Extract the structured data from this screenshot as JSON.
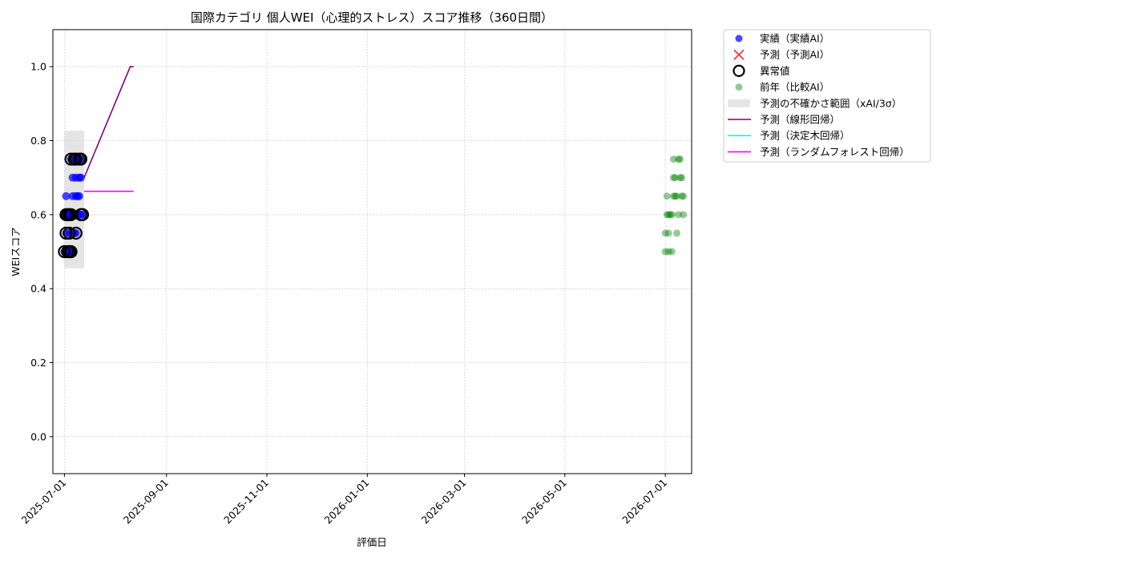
{
  "chart_data": {
    "type": "scatter",
    "title": "国際カテゴリ 個人WEI（心理的ストレス）スコア推移（360日間）",
    "xlabel": "評価日",
    "ylabel": "WEIスコア",
    "xlim": [
      "2025-06-24",
      "2026-07-17"
    ],
    "ylim": [
      -0.1,
      1.1
    ],
    "yticks": [
      0.0,
      0.2,
      0.4,
      0.6,
      0.8,
      1.0
    ],
    "ytick_labels": [
      "0.0",
      "0.2",
      "0.4",
      "0.6",
      "0.8",
      "1.0"
    ],
    "xticks": [
      "2025-07-01",
      "2025-09-01",
      "2025-11-01",
      "2026-01-01",
      "2026-03-01",
      "2026-05-01",
      "2026-07-01"
    ],
    "grid": true,
    "legend_position": "outside upper-right",
    "series": [
      {
        "name": "実績（実績AI）",
        "kind": "scatter",
        "color": "#0000ff",
        "points": [
          [
            "2025-07-01",
            0.5
          ],
          [
            "2025-07-02",
            0.55
          ],
          [
            "2025-07-02",
            0.6
          ],
          [
            "2025-07-02",
            0.65
          ],
          [
            "2025-07-03",
            0.5
          ],
          [
            "2025-07-03",
            0.6
          ],
          [
            "2025-07-04",
            0.55
          ],
          [
            "2025-07-04",
            0.5
          ],
          [
            "2025-07-04",
            0.6
          ],
          [
            "2025-07-05",
            0.75
          ],
          [
            "2025-07-05",
            0.6
          ],
          [
            "2025-07-05",
            0.5
          ],
          [
            "2025-07-06",
            0.7
          ],
          [
            "2025-07-06",
            0.65
          ],
          [
            "2025-07-07",
            0.6
          ],
          [
            "2025-07-07",
            0.75
          ],
          [
            "2025-07-07",
            0.55
          ],
          [
            "2025-07-08",
            0.75
          ],
          [
            "2025-07-08",
            0.7
          ],
          [
            "2025-07-08",
            0.65
          ],
          [
            "2025-07-08",
            0.55
          ],
          [
            "2025-07-09",
            0.75
          ],
          [
            "2025-07-09",
            0.65
          ],
          [
            "2025-07-09",
            0.6
          ],
          [
            "2025-07-10",
            0.75
          ],
          [
            "2025-07-10",
            0.7
          ],
          [
            "2025-07-10",
            0.65
          ],
          [
            "2025-07-11",
            0.75
          ],
          [
            "2025-07-11",
            0.7
          ],
          [
            "2025-07-11",
            0.6
          ],
          [
            "2025-07-12",
            0.6
          ]
        ]
      },
      {
        "name": "予測（予測AI）",
        "kind": "marker-x",
        "color": "#ff0000",
        "points": []
      },
      {
        "name": "異常値",
        "kind": "ring",
        "color": "#000000",
        "points": [
          [
            "2025-07-01",
            0.5
          ],
          [
            "2025-07-02",
            0.55
          ],
          [
            "2025-07-02",
            0.6
          ],
          [
            "2025-07-03",
            0.5
          ],
          [
            "2025-07-03",
            0.6
          ],
          [
            "2025-07-04",
            0.55
          ],
          [
            "2025-07-04",
            0.5
          ],
          [
            "2025-07-04",
            0.6
          ],
          [
            "2025-07-05",
            0.75
          ],
          [
            "2025-07-05",
            0.6
          ],
          [
            "2025-07-05",
            0.5
          ],
          [
            "2025-07-07",
            0.75
          ],
          [
            "2025-07-08",
            0.75
          ],
          [
            "2025-07-08",
            0.55
          ],
          [
            "2025-07-10",
            0.75
          ],
          [
            "2025-07-11",
            0.75
          ],
          [
            "2025-07-11",
            0.6
          ],
          [
            "2025-07-12",
            0.6
          ]
        ]
      },
      {
        "name": "前年（比較AI）",
        "kind": "scatter",
        "color": "#008000",
        "points": [
          [
            "2026-07-01",
            0.5
          ],
          [
            "2026-07-01",
            0.55
          ],
          [
            "2026-07-02",
            0.6
          ],
          [
            "2026-07-02",
            0.65
          ],
          [
            "2026-07-03",
            0.5
          ],
          [
            "2026-07-03",
            0.55
          ],
          [
            "2026-07-03",
            0.6
          ],
          [
            "2026-07-04",
            0.6
          ],
          [
            "2026-07-05",
            0.5
          ],
          [
            "2026-07-05",
            0.6
          ],
          [
            "2026-07-06",
            0.7
          ],
          [
            "2026-07-06",
            0.65
          ],
          [
            "2026-07-06",
            0.75
          ],
          [
            "2026-07-07",
            0.65
          ],
          [
            "2026-07-07",
            0.7
          ],
          [
            "2026-07-08",
            0.55
          ],
          [
            "2026-07-08",
            0.65
          ],
          [
            "2026-07-09",
            0.6
          ],
          [
            "2026-07-09",
            0.75
          ],
          [
            "2026-07-10",
            0.7
          ],
          [
            "2026-07-10",
            0.75
          ],
          [
            "2026-07-11",
            0.65
          ],
          [
            "2026-07-11",
            0.7
          ],
          [
            "2026-07-12",
            0.6
          ],
          [
            "2026-07-12",
            0.65
          ]
        ]
      },
      {
        "name": "予測の不確かさ範囲（xAI/3σ）",
        "kind": "band",
        "color": "#d3d3d3",
        "x": [
          "2025-07-01",
          "2025-07-13"
        ],
        "y": [
          0.455,
          0.827
        ]
      },
      {
        "name": "予測（線形回帰）",
        "kind": "line",
        "color": "#800080",
        "points": [
          [
            "2025-07-13",
            0.7
          ],
          [
            "2025-08-10",
            1.0
          ],
          [
            "2025-08-12",
            1.0
          ]
        ]
      },
      {
        "name": "予測（決定木回帰）",
        "kind": "line",
        "color": "#00ffff",
        "points": []
      },
      {
        "name": "予測（ランダムフォレスト回帰）",
        "kind": "line",
        "color": "#ff00ff",
        "points": [
          [
            "2025-07-13",
            0.663
          ],
          [
            "2025-08-12",
            0.663
          ]
        ]
      }
    ]
  }
}
